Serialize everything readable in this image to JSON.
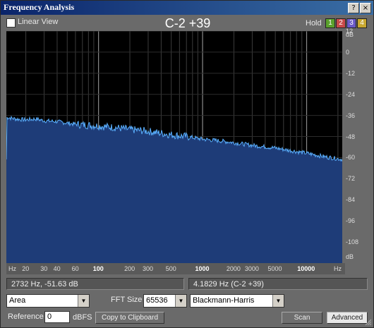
{
  "window": {
    "title": "Frequency Analysis",
    "buttons": {
      "help": "?",
      "close": "×"
    }
  },
  "toolbar": {
    "linear_view_label": "Linear View",
    "linear_view_checked": false,
    "note": "C-2 +39",
    "hold_label": "Hold",
    "hold_buttons": [
      {
        "label": "1",
        "color": "#5aa02c"
      },
      {
        "label": "2",
        "color": "#c84a4a"
      },
      {
        "label": "3",
        "color": "#6a5ac8"
      },
      {
        "label": "4",
        "color": "#c8a830"
      }
    ]
  },
  "chart_data": {
    "type": "area",
    "xscale": "log",
    "xunit": "Hz",
    "yunit": "dB",
    "xlim": [
      13,
      22000
    ],
    "ylim": [
      -120,
      12
    ],
    "y_ticks": [
      "12",
      "0",
      "-12",
      "-24",
      "-36",
      "-48",
      "-60",
      "-72",
      "-84",
      "-96",
      "-108"
    ],
    "x_ticks": [
      "20",
      "30",
      "40",
      "60",
      "100",
      "200",
      "300",
      "500",
      "1000",
      "2000",
      "3000",
      "5000",
      "10000"
    ],
    "x_major": [
      "100",
      "1000",
      "10000"
    ],
    "series": [
      {
        "color": "#1e3c78",
        "line_color": "#5ab0ff",
        "points": [
          [
            13,
            -37
          ],
          [
            16,
            -38
          ],
          [
            20,
            -38.5
          ],
          [
            25,
            -38
          ],
          [
            30,
            -39
          ],
          [
            40,
            -39.5
          ],
          [
            60,
            -41
          ],
          [
            100,
            -42
          ],
          [
            150,
            -43
          ],
          [
            200,
            -44
          ],
          [
            300,
            -45
          ],
          [
            500,
            -47
          ],
          [
            700,
            -48
          ],
          [
            1000,
            -49.5
          ],
          [
            1500,
            -50.5
          ],
          [
            2000,
            -51.5
          ],
          [
            3000,
            -53
          ],
          [
            5000,
            -54.5
          ],
          [
            7000,
            -56
          ],
          [
            10000,
            -57.5
          ],
          [
            15000,
            -59.5
          ],
          [
            22000,
            -61
          ]
        ]
      }
    ]
  },
  "info": {
    "cursor": "2732 Hz, -51.63 dB",
    "peak": "4.1829 Hz (C-2 +39)"
  },
  "controls": {
    "display_mode": "Area",
    "fft_size_label": "FFT Size",
    "fft_size": "65536",
    "window_function": "Blackmann-Harris",
    "reference_label": "Reference",
    "reference_value": "0",
    "reference_unit": "dBFS",
    "copy_label": "Copy to Clipboard",
    "scan_label": "Scan",
    "advanced_label": "Advanced"
  }
}
